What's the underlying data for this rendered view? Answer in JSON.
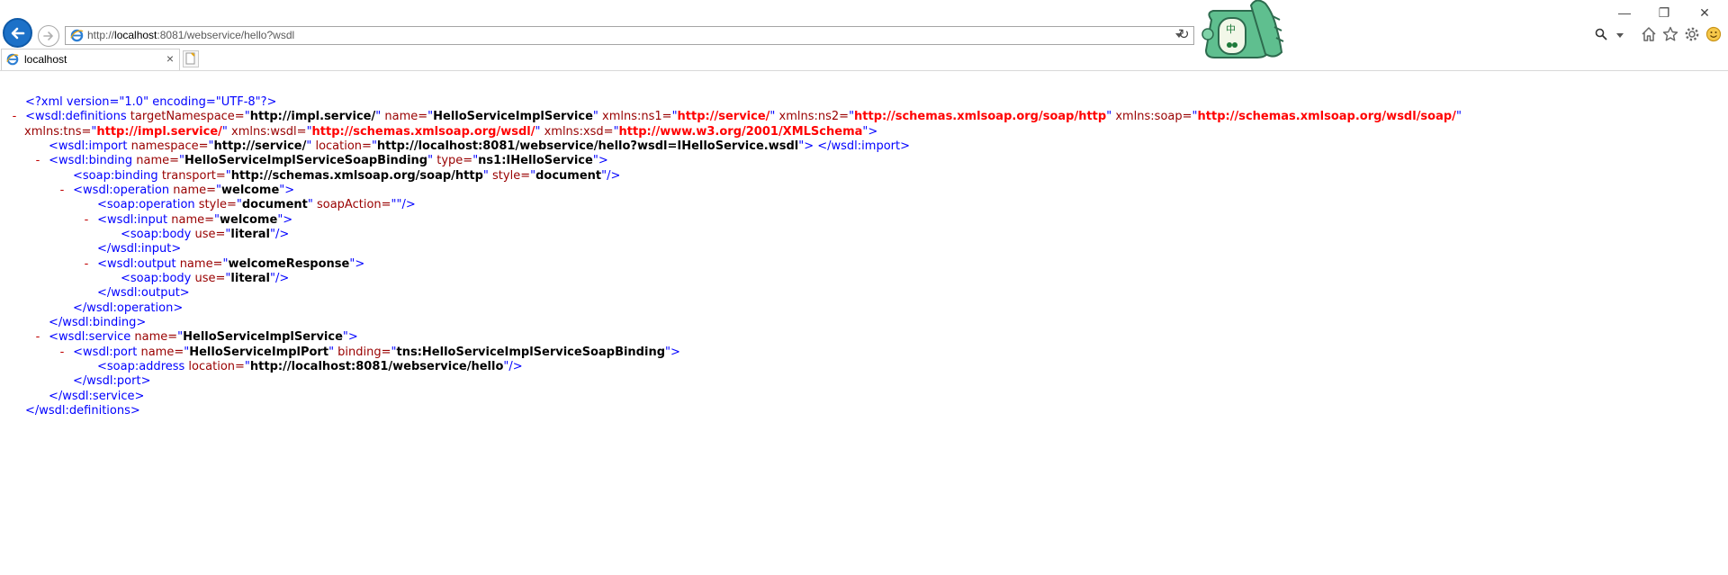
{
  "browser": {
    "address_url_prefix": "http://",
    "address_url_host": "localhost",
    "address_url_rest": ":8081/webservice/hello?wsdl",
    "tab_title": "localhost",
    "tab_close": "×",
    "window_minimize": "—",
    "window_restore": "❐",
    "window_close": "✕",
    "refresh_glyph": "↻",
    "mascot_char": "中",
    "icons": [
      "back-icon",
      "forward-icon",
      "ie-icon",
      "dropdown-icon",
      "refresh-icon",
      "search-icon",
      "home-icon",
      "star-icon",
      "gear-icon",
      "smiley-icon"
    ]
  },
  "xml": {
    "pi": {
      "open": "<?xml ",
      "version_attr": "version=",
      "version_val": "\"1.0\"",
      "encoding_attr": " encoding=",
      "encoding_val": "\"UTF-8\"",
      "close": "?>"
    },
    "definitions": {
      "minus": "-",
      "open_tag": "<wsdl:definitions",
      "attrs1": [
        {
          "name": " targetNamespace=",
          "q1": "\"",
          "val": "http://impl.service/",
          "q2": "\"",
          "ns": false
        },
        {
          "name": " name=",
          "q1": "\"",
          "val": "HelloServiceImplService",
          "q2": "\"",
          "ns": false
        },
        {
          "name": " xmlns:ns1=",
          "q1": "\"",
          "val": "http://service/",
          "q2": "\"",
          "ns": true
        },
        {
          "name": " xmlns:ns2=",
          "q1": "\"",
          "val": "http://schemas.xmlsoap.org/soap/http",
          "q2": "\"",
          "ns": true
        },
        {
          "name": " xmlns:soap=",
          "q1": "\"",
          "val": "http://schemas.xmlsoap.org/wsdl/soap/",
          "q2": "\"",
          "ns": true
        }
      ],
      "attrs2": [
        {
          "name": "xmlns:tns=",
          "q1": "\"",
          "val": "http://impl.service/",
          "q2": "\"",
          "ns": true
        },
        {
          "name": " xmlns:wsdl=",
          "q1": "\"",
          "val": "http://schemas.xmlsoap.org/wsdl/",
          "q2": "\"",
          "ns": true
        },
        {
          "name": " xmlns:xsd=",
          "q1": "\"",
          "val": "http://www.w3.org/2001/XMLSchema",
          "q2": "\"",
          "ns": true
        }
      ],
      "gt": ">",
      "close_tag": "</wsdl:definitions>"
    },
    "import_line": {
      "open": "<wsdl:import",
      "a1": " namespace=",
      "v1": "http://service/",
      "a2": " location=",
      "v2": "http://localhost:8081/webservice/hello?wsdl=IHelloService.wsdl",
      "end": ">",
      "close": " </wsdl:import>"
    },
    "binding": {
      "minus": "-",
      "open": "<wsdl:binding",
      "a1": " name=",
      "v1": "HelloServiceImplServiceSoapBinding",
      "a2": " type=",
      "v2": "ns1:IHelloService",
      "end": ">",
      "close": "</wsdl:binding>"
    },
    "soap_binding": {
      "open": "<soap:binding",
      "a1": " transport=",
      "v1": "http://schemas.xmlsoap.org/soap/http",
      "a2": " style=",
      "v2": "document",
      "end": "/>"
    },
    "operation": {
      "minus": "-",
      "open": "<wsdl:operation",
      "a1": " name=",
      "v1": "welcome",
      "end": ">",
      "close": "</wsdl:operation>"
    },
    "soap_operation": {
      "open": "<soap:operation",
      "a1": " style=",
      "v1": "document",
      "a2": " soapAction=",
      "v2": "",
      "end": "/>"
    },
    "input": {
      "minus": "-",
      "open": "<wsdl:input",
      "a1": " name=",
      "v1": "welcome",
      "end": ">",
      "close": "</wsdl:input>"
    },
    "input_body": {
      "open": "<soap:body",
      "a1": " use=",
      "v1": "literal",
      "end": "/>"
    },
    "output": {
      "minus": "-",
      "open": "<wsdl:output",
      "a1": " name=",
      "v1": "welcomeResponse",
      "end": ">",
      "close": "</wsdl:output>"
    },
    "output_body": {
      "open": "<soap:body",
      "a1": " use=",
      "v1": "literal",
      "end": "/>"
    },
    "service": {
      "minus": "-",
      "open": "<wsdl:service",
      "a1": " name=",
      "v1": "HelloServiceImplService",
      "end": ">",
      "close": "</wsdl:service>"
    },
    "port": {
      "minus": "-",
      "open": "<wsdl:port",
      "a1": " name=",
      "v1": "HelloServiceImplPort",
      "a2": " binding=",
      "v2": "tns:HelloServiceImplServiceSoapBinding",
      "end": ">",
      "close": "</wsdl:port>"
    },
    "address": {
      "open": "<soap:address",
      "a1": " location=",
      "v1": "http://localhost:8081/webservice/hello",
      "end": "/>"
    },
    "quote": "\""
  }
}
